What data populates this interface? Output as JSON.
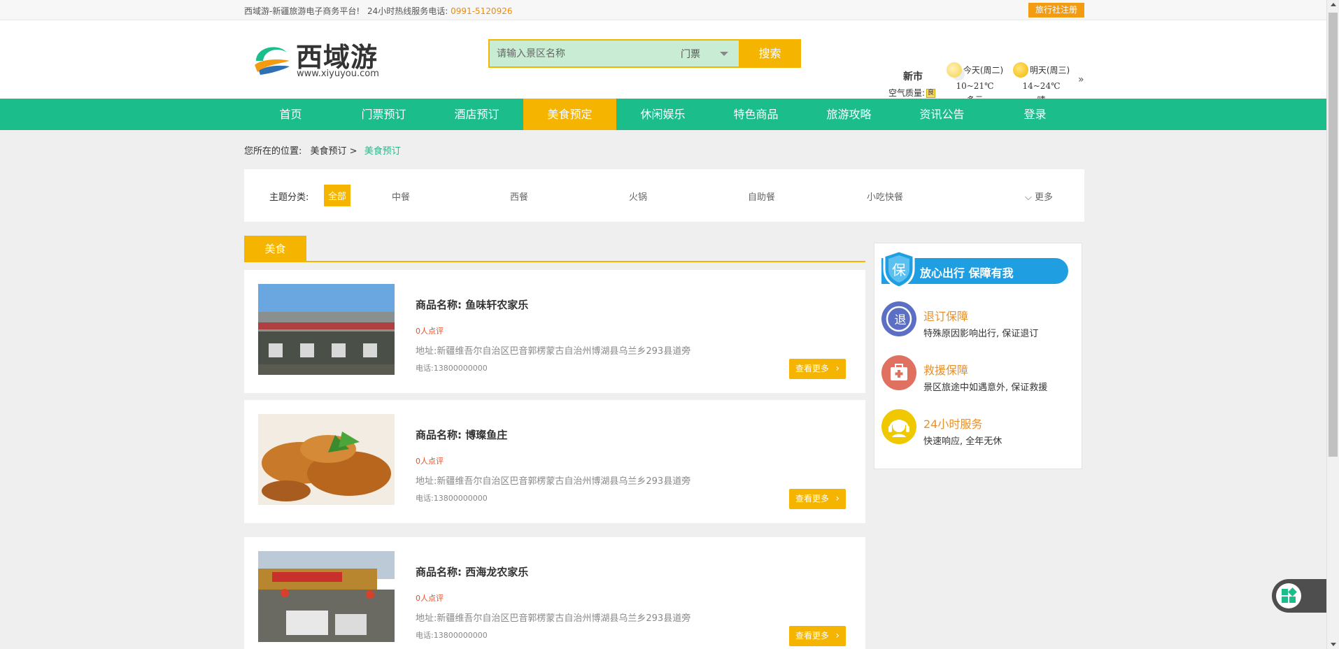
{
  "topbar": {
    "welcome": "西域游-新疆旅游电子商务平台!",
    "hotline_label": "24小时热线服务电话:",
    "hotline_number": "0991-5120926",
    "agency_register": "旅行社注册"
  },
  "header": {
    "logo_text": "西域游",
    "logo_url": "www.xiyuyou.com",
    "search": {
      "placeholder": "请输入景区名称",
      "type_selected": "门票",
      "button_label": "搜索"
    },
    "weather": {
      "city": "新市",
      "air_quality_label": "空气质量:",
      "air_quality_value": "良",
      "today": {
        "label": "今天(周二)",
        "temp": "10~21℃",
        "desc": "多云"
      },
      "tomorrow": {
        "label": "明天(周三)",
        "temp": "14~24℃",
        "desc": "晴"
      },
      "more": "»"
    }
  },
  "nav": {
    "items": [
      "首页",
      "门票预订",
      "酒店预订",
      "美食预定",
      "休闲娱乐",
      "特色商品",
      "旅游攻略",
      "资讯公告",
      "登录"
    ],
    "active_index": 3
  },
  "breadcrumb": {
    "prefix": "您所在的位置:",
    "parent": "美食预订 >",
    "current": "美食预订"
  },
  "filter": {
    "label": "主题分类:",
    "categories": [
      "全部",
      "中餐",
      "西餐",
      "火锅",
      "自助餐",
      "小吃快餐"
    ],
    "more": "更多"
  },
  "section": {
    "tab": "美食"
  },
  "listings": [
    {
      "name": "商品名称: 鱼味轩农家乐",
      "reviews": "0人点评",
      "address": "地址:新疆维吾尔自治区巴音郭楞蒙古自治州博湖县乌兰乡293县道旁",
      "tel": "电话:13800000000",
      "more": "查看更多"
    },
    {
      "name": "商品名称: 博璨鱼庄",
      "reviews": "0人点评",
      "address": "地址:新疆维吾尔自治区巴音郭楞蒙古自治州博湖县乌兰乡293县道旁",
      "tel": "电话:13800000000",
      "more": "查看更多"
    },
    {
      "name": "商品名称: 西海龙农家乐",
      "reviews": "0人点评",
      "address": "地址:新疆维吾尔自治区巴音郭楞蒙古自治州博湖县乌兰乡293县道旁",
      "tel": "电话:13800000000",
      "more": "查看更多"
    }
  ],
  "sidebar": {
    "banner": "放心出行  保障有我",
    "shield_char": "保",
    "guarantees": [
      {
        "icon": "refund-icon",
        "icon_char": "退",
        "title": "退订保障",
        "sub": "特殊原因影响出行, 保证退订",
        "color": "#5b6fc4"
      },
      {
        "icon": "first-aid-icon",
        "icon_char": "+",
        "title": "救援保障",
        "sub": "景区旅途中如遇意外, 保证救援",
        "color": "#e07060"
      },
      {
        "icon": "headset-icon",
        "icon_char": "☺",
        "title": "24小时服务",
        "sub": "快速响应, 全年无休",
        "color": "#f0c800"
      }
    ]
  }
}
